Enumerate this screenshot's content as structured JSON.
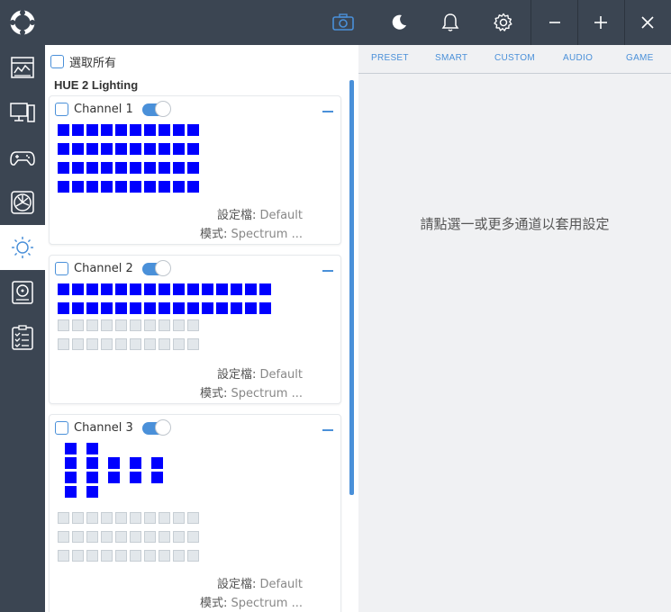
{
  "leftpanel": {
    "select_all_label": "選取所有",
    "section_title": "HUE 2 Lighting",
    "channels": [
      {
        "name": "Channel 1",
        "profile_label": "設定檔:",
        "profile_value": "Default",
        "mode_label": "模式:",
        "mode_value": "Spectrum ..."
      },
      {
        "name": "Channel 2",
        "profile_label": "設定檔:",
        "profile_value": "Default",
        "mode_label": "模式:",
        "mode_value": "Spectrum ..."
      },
      {
        "name": "Channel 3",
        "profile_label": "設定檔:",
        "profile_value": "Default",
        "mode_label": "模式:",
        "mode_value": "Spectrum ..."
      }
    ]
  },
  "rightpanel": {
    "tabs": [
      "PRESET",
      "SMART",
      "CUSTOM",
      "AUDIO",
      "GAME"
    ],
    "hint": "請點選一或更多通道以套用設定"
  },
  "topbar": {
    "icons": [
      "camera-icon",
      "moon-icon",
      "bell-icon",
      "gear-icon",
      "minimize-icon",
      "maximize-icon",
      "close-icon"
    ]
  },
  "sidebar": {
    "icons": [
      "dashboard-icon",
      "monitor-icon",
      "gamepad-icon",
      "fan-icon",
      "lighting-icon",
      "storage-icon",
      "checklist-icon"
    ],
    "active": "lighting-icon"
  },
  "colors": {
    "accent": "#4a90d9",
    "led_on": "#0000ff",
    "sidebar_bg": "#3b4552"
  }
}
